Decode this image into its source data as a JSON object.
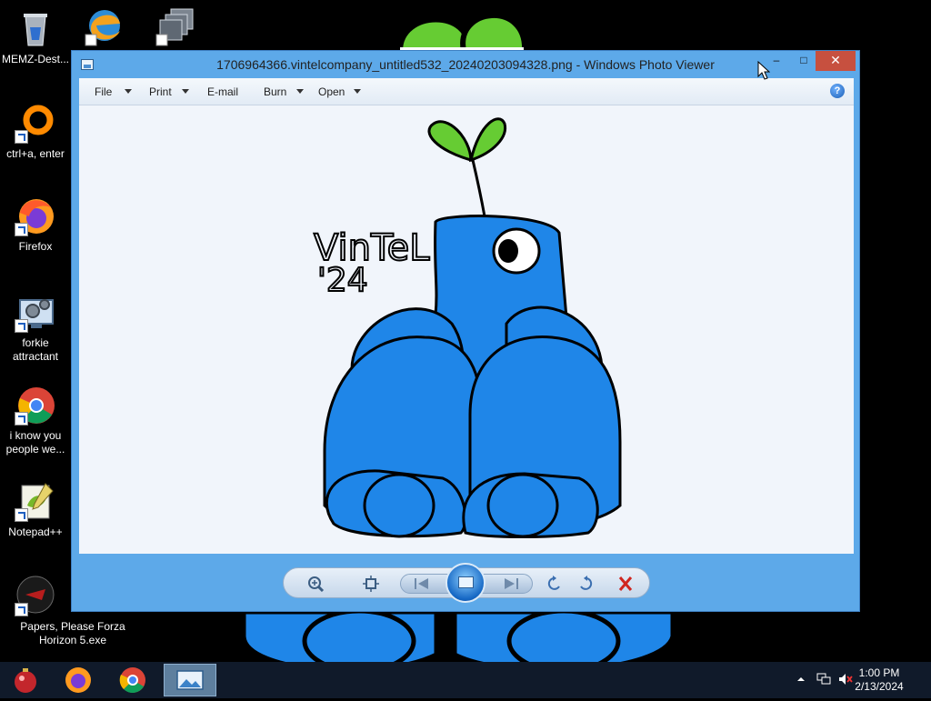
{
  "desktop": {
    "icons": [
      {
        "label": "MEMZ-Dest...",
        "icon": "recycle-bin-icon"
      },
      {
        "label": "ctrl+a, enter",
        "icon": "orange-ring-icon"
      },
      {
        "label": "Firefox",
        "icon": "firefox-icon"
      },
      {
        "label": "forkie attractant",
        "icon": "gear-monitor-icon"
      },
      {
        "label": "i know you people we...",
        "icon": "chrome-icon"
      },
      {
        "label": "Notepad++",
        "icon": "notepadpp-icon"
      },
      {
        "label": "Papers, Please Forza Horizon 5.exe",
        "icon": "papers-please-icon"
      }
    ],
    "top_icons": [
      "edge-legacy-icon",
      "stacked-windows-icon"
    ]
  },
  "window": {
    "title": "1706964366.vintelcompany_untitled532_20240203094328.png - Windows Photo Viewer",
    "caption_buttons": {
      "minimize": "–",
      "maximize": "□",
      "close": "✕"
    },
    "menu": [
      {
        "label": "File",
        "has_dropdown": true
      },
      {
        "label": "Print",
        "has_dropdown": true
      },
      {
        "label": "E-mail",
        "has_dropdown": false
      },
      {
        "label": "Burn",
        "has_dropdown": true
      },
      {
        "label": "Open",
        "has_dropdown": true
      }
    ],
    "help_label": "?",
    "image": {
      "signature_text": "VinTeL '24"
    },
    "controls": [
      "zoom-icon",
      "actual-size-icon",
      "previous-icon",
      "slideshow-icon",
      "next-icon",
      "rotate-left-icon",
      "rotate-right-icon",
      "delete-icon"
    ]
  },
  "taskbar": {
    "clock_time": "1:00 PM",
    "clock_date": "2/13/2024",
    "pinned": [
      "ornament-icon",
      "firefox-icon",
      "chrome-icon",
      "photo-viewer-icon"
    ]
  },
  "colors": {
    "window_frame": "#5da9e9",
    "close_button": "#c7503f",
    "creature_blue": "#1f86e8",
    "sprout_green": "#66cc33",
    "taskbar": "#101a2a"
  }
}
